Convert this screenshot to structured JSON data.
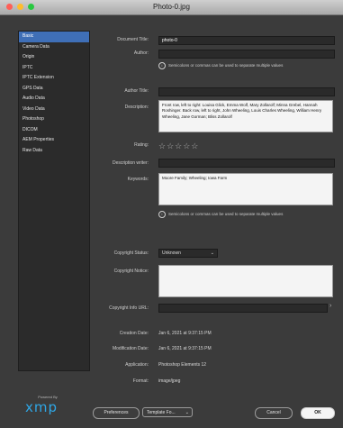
{
  "window": {
    "title": "Photo-0.jpg"
  },
  "sidebar": {
    "items": [
      {
        "label": "Basic"
      },
      {
        "label": "Camera Data"
      },
      {
        "label": "Origin"
      },
      {
        "label": "IPTC"
      },
      {
        "label": "IPTC Extension"
      },
      {
        "label": "GPS Data"
      },
      {
        "label": "Audio Data"
      },
      {
        "label": "Video Data"
      },
      {
        "label": "Photoshop"
      },
      {
        "label": "DICOM"
      },
      {
        "label": "AEM Properties"
      },
      {
        "label": "Raw Data"
      }
    ]
  },
  "logo": {
    "powered_by": "Powered By",
    "name": "xmp"
  },
  "form": {
    "document_title": {
      "label": "Document Title:",
      "value": "photo-0"
    },
    "author": {
      "label": "Author:",
      "value": ""
    },
    "tip1": "Semicolons or commas can be used to separate multiple values",
    "author_title": {
      "label": "Author Title:",
      "value": ""
    },
    "description": {
      "label": "Description:",
      "value": "Front row, left to right: Louisa Glick, Emma Wolf, Mary Zollarolf; Minna Grebel, Hannah Roshinger. Back row, left to right, John Wheeling, Louis Charles Wheeling, William Henry Wheeling, Jane Gorman; Bliss Zollarolf"
    },
    "rating": {
      "label": "Rating:",
      "stars": "☆☆☆☆☆",
      "value": 0
    },
    "description_writer": {
      "label": "Description writer:",
      "value": ""
    },
    "keywords": {
      "label": "Keywords:",
      "value": "Moore Family; Wheeling; Iowa Farm"
    },
    "tip2": "Semicolons or commas can be used to separate multiple values",
    "copyright_status": {
      "label": "Copyright Status:",
      "value": "Unknown"
    },
    "copyright_notice": {
      "label": "Copyright Notice:",
      "value": ""
    },
    "copyright_info_url": {
      "label": "Copyright Info URL:",
      "value": ""
    },
    "creation_date": {
      "label": "Creation Date:",
      "value": "Jan 6, 2021 at 9:37:15 PM"
    },
    "modification_date": {
      "label": "Modification Date:",
      "value": "Jan 6, 2021 at 9:37:15 PM"
    },
    "application": {
      "label": "Application:",
      "value": "Photoshop Elements 12"
    },
    "format": {
      "label": "Format:",
      "value": "image/jpeg"
    }
  },
  "buttons": {
    "preferences": "Preferences",
    "template": "Template Fo...",
    "cancel": "Cancel",
    "ok": "OK"
  }
}
